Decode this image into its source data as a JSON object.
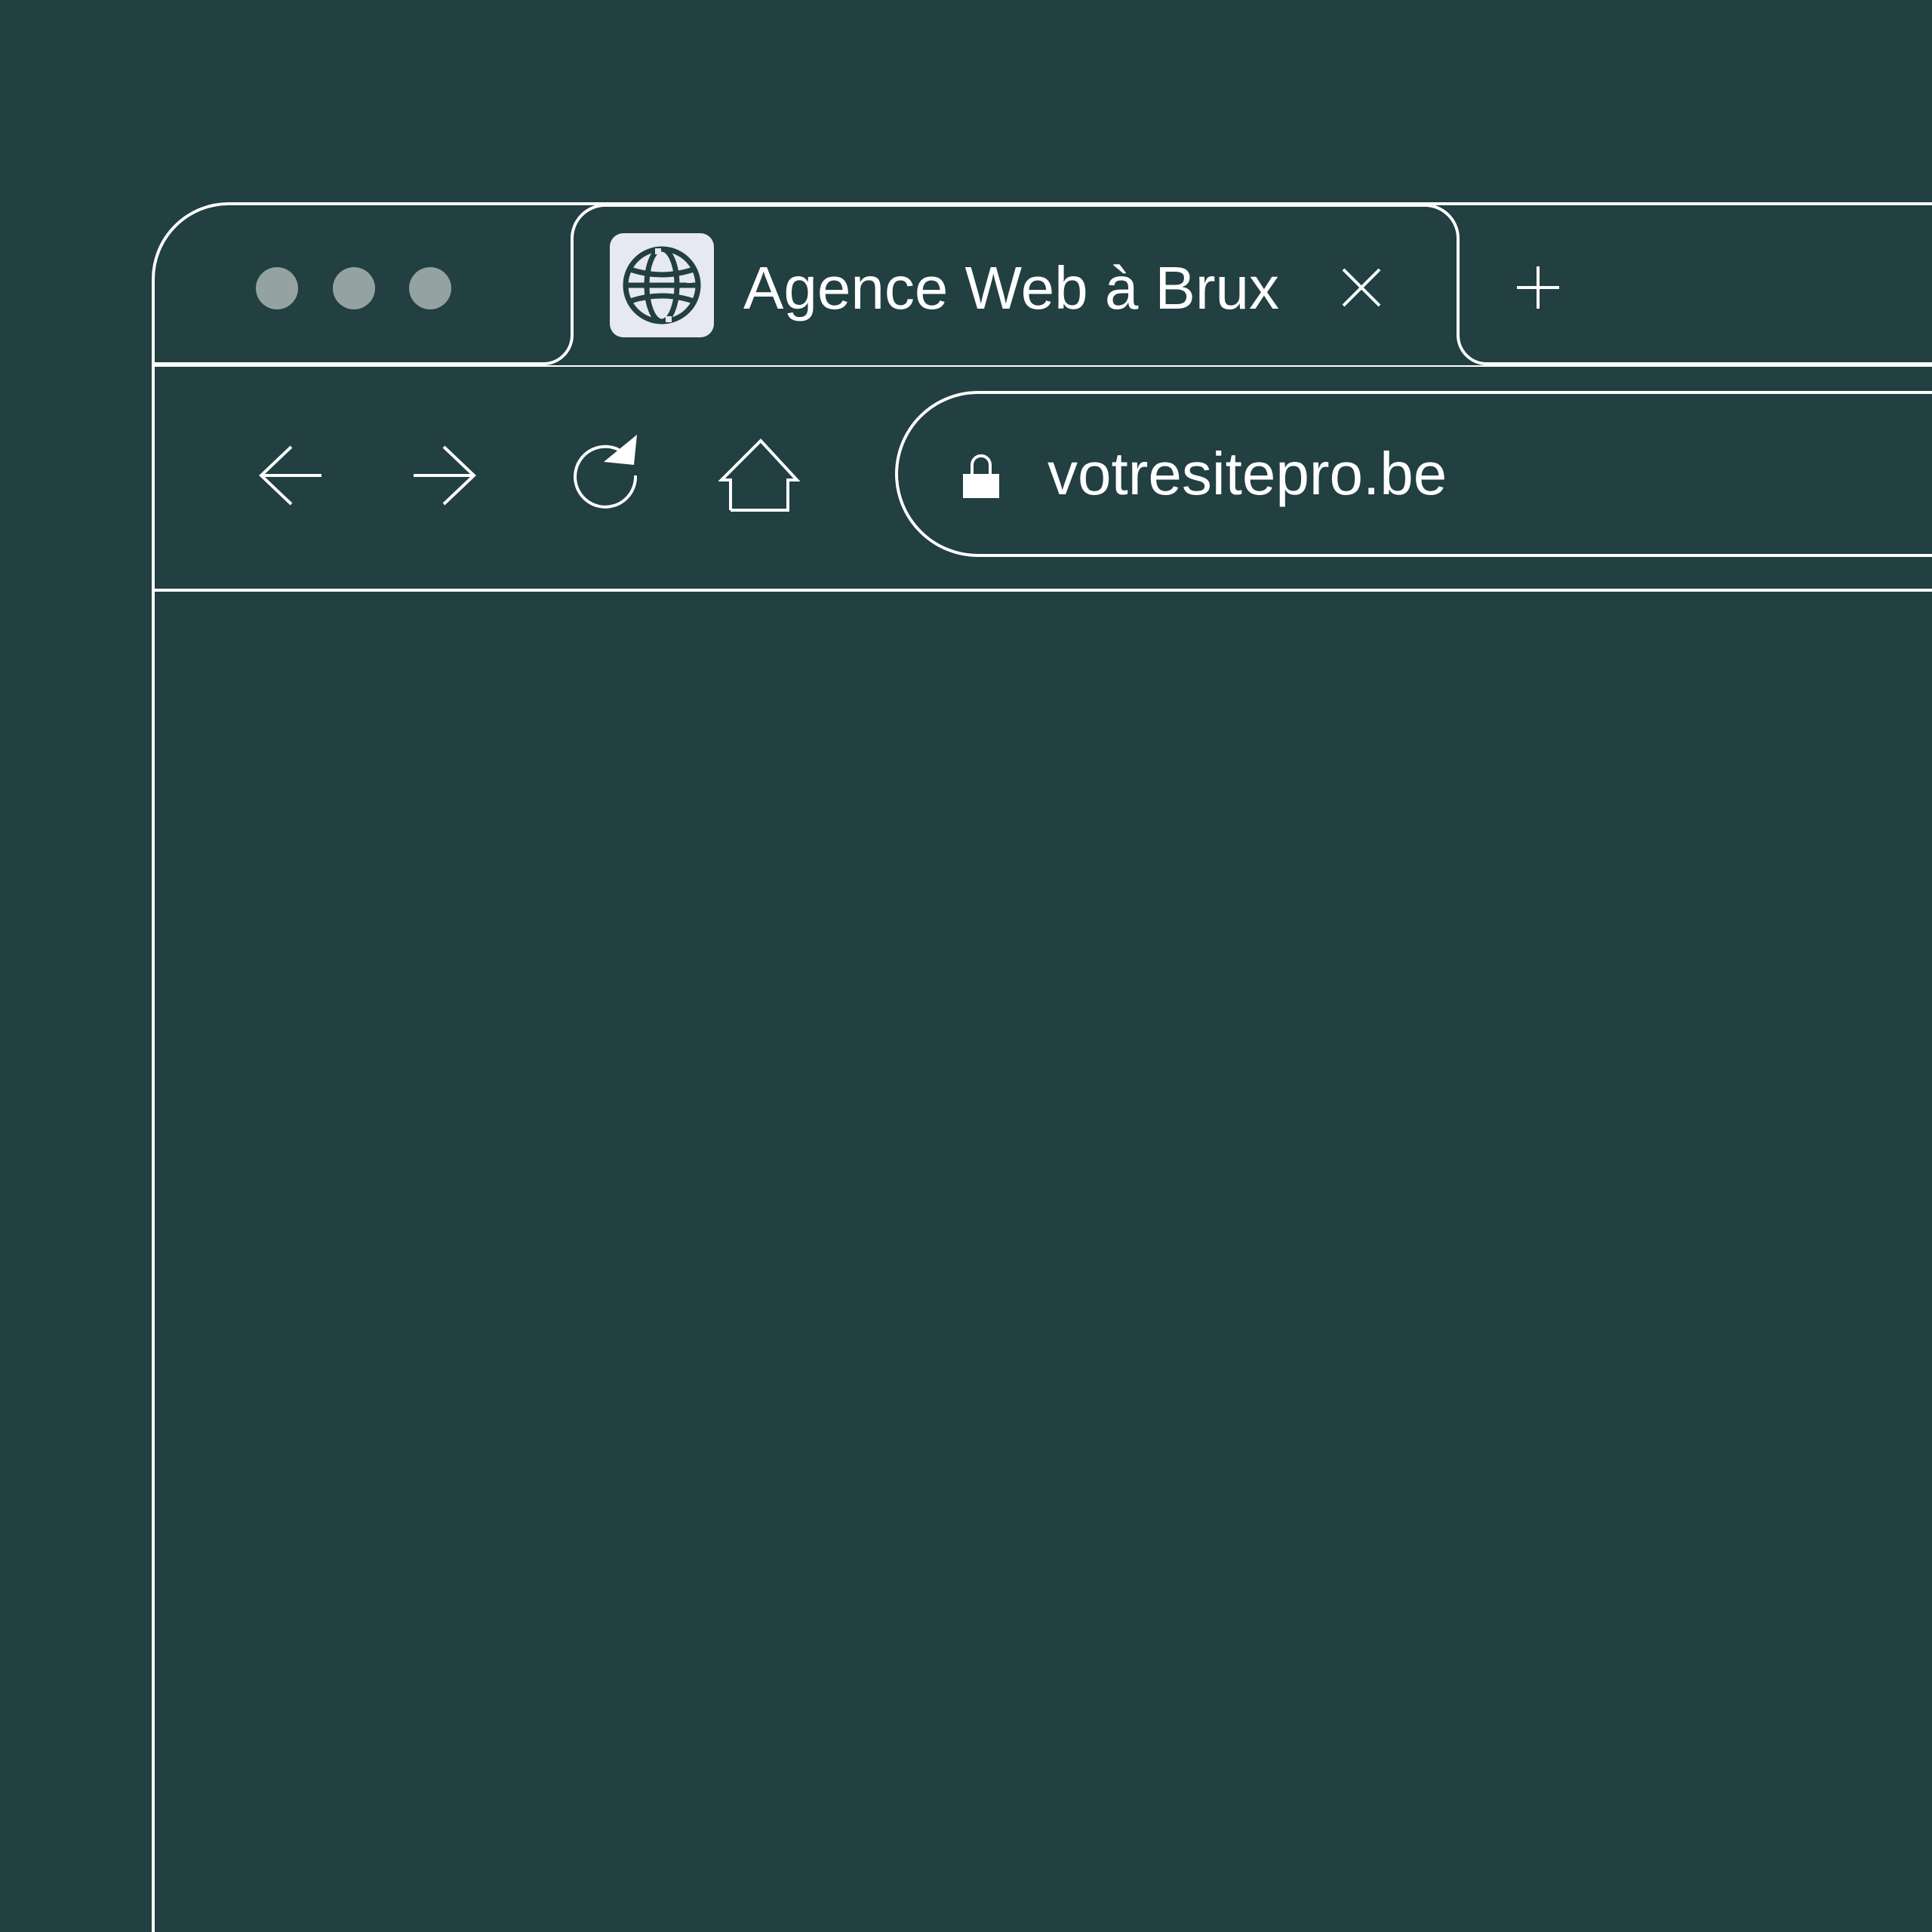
{
  "colors": {
    "background": "#223f41",
    "line": "#ffffff",
    "window_dot": "#94a3a2",
    "favicon_bg": "#e6e8f4",
    "favicon_fg": "#223f41"
  },
  "window_controls": [
    "window-dot",
    "window-dot",
    "window-dot"
  ],
  "tabs": [
    {
      "title": "Agence Web à Brux",
      "favicon": "globe-icon",
      "close_icon": "close-icon",
      "active": true
    }
  ],
  "new_tab_icon": "plus-icon",
  "toolbar": {
    "back_icon": "arrow-left-icon",
    "forward_icon": "arrow-right-icon",
    "reload_icon": "reload-icon",
    "home_icon": "home-icon"
  },
  "address_bar": {
    "secure_icon": "lock-icon",
    "url": "votresitepro.be"
  }
}
